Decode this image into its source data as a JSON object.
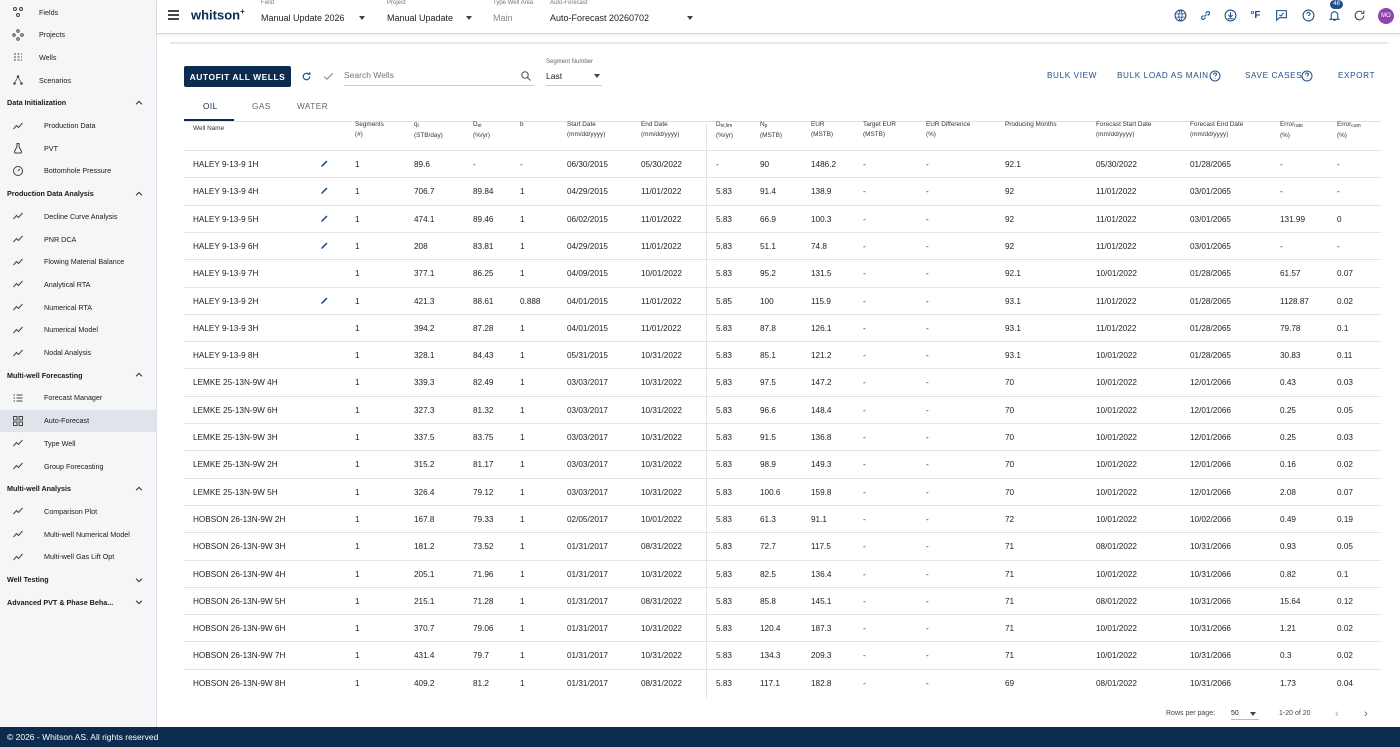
{
  "sidebar": {
    "top": [
      {
        "label": "Fields",
        "icon": "fields-icon"
      },
      {
        "label": "Projects",
        "icon": "projects-icon"
      },
      {
        "label": "Wells",
        "icon": "wells-icon"
      },
      {
        "label": "Scenarios",
        "icon": "scenarios-icon"
      }
    ],
    "sections": [
      {
        "label": "Data Initialization",
        "items": [
          {
            "label": "Production Data",
            "icon": "production-icon"
          },
          {
            "label": "PVT",
            "icon": "flask-icon"
          },
          {
            "label": "Bottomhole Pressure",
            "icon": "gauge-icon"
          }
        ]
      },
      {
        "label": "Production Data Analysis",
        "items": [
          {
            "label": "Decline Curve Analysis",
            "icon": "decline-icon"
          },
          {
            "label": "PNR DCA",
            "icon": "pnr-icon"
          },
          {
            "label": "Flowing Material Balance",
            "icon": "fmb-icon"
          },
          {
            "label": "Analytical RTA",
            "icon": "analytical-icon"
          },
          {
            "label": "Numerical RTA",
            "icon": "numerical-rta-icon"
          },
          {
            "label": "Numerical Model",
            "icon": "model-icon"
          },
          {
            "label": "Nodal Analysis",
            "icon": "nodal-icon"
          }
        ]
      },
      {
        "label": "Multi-well Forecasting",
        "items": [
          {
            "label": "Forecast Manager",
            "icon": "list-icon"
          },
          {
            "label": "Auto-Forecast",
            "icon": "grid-icon"
          },
          {
            "label": "Type Well",
            "icon": "typewell-icon"
          },
          {
            "label": "Group Forecasting",
            "icon": "group-icon"
          }
        ]
      },
      {
        "label": "Multi-well Analysis",
        "items": [
          {
            "label": "Comparison Plot",
            "icon": "comparison-icon"
          },
          {
            "label": "Multi-well Numerical Model",
            "icon": "multimodel-icon"
          },
          {
            "label": "Multi-well Gas Lift Opt",
            "icon": "gaslift-icon"
          }
        ]
      },
      {
        "label": "Well Testing",
        "items": []
      },
      {
        "label": "Advanced PVT & Phase Beha...",
        "items": []
      }
    ]
  },
  "footer": "© 2026 - Whitson AS. All rights reserved",
  "topbar": {
    "brand": "whitson",
    "brand_sup": "+",
    "field": {
      "caption": "Field",
      "value": "Manual Update 2026"
    },
    "project": {
      "caption": "Project",
      "value": "Manual Upadate"
    },
    "type_well_area": {
      "caption": "Type Well Area",
      "value": "Main"
    },
    "auto_forecast": {
      "caption": "Auto-Forecast",
      "value": "Auto-Forecast 20260702"
    },
    "temp_unit": "°F",
    "notifications": "48",
    "avatar": "MO"
  },
  "toolbar": {
    "autofit": "AUTOFIT ALL WELLS",
    "search_placeholder": "Search Wells",
    "segment_caption": "Segment Number",
    "segment_value": "Last",
    "bulk_view": "BULK VIEW",
    "bulk_load": "BULK LOAD AS MAIN",
    "save_cases": "SAVE CASES",
    "export": "EXPORT"
  },
  "tabs": [
    "OIL",
    "GAS",
    "WATER"
  ],
  "columns": [
    {
      "l1": "Well Name",
      "l2": ""
    },
    {
      "l1": "Segments",
      "l2": "(#)"
    },
    {
      "l1": "qi",
      "l2": "(STB/day)"
    },
    {
      "l1": "Dei",
      "l2": "(%/yr)"
    },
    {
      "l1": "b",
      "l2": ""
    },
    {
      "l1": "Start Date",
      "l2": "(mm/dd/yyyy)"
    },
    {
      "l1": "End Date",
      "l2": "(mm/dd/yyyy)"
    },
    {
      "l1": "Dei,lim",
      "l2": "(%/yr)"
    },
    {
      "l1": "Np",
      "l2": "(MSTB)"
    },
    {
      "l1": "EUR",
      "l2": "(MSTB)"
    },
    {
      "l1": "Target EUR",
      "l2": "(MSTB)"
    },
    {
      "l1": "EUR Difference",
      "l2": "(%)"
    },
    {
      "l1": "Producing Months",
      "l2": ""
    },
    {
      "l1": "Forecast Start Date",
      "l2": "(mm/dd/yyyy)"
    },
    {
      "l1": "Forecast End Date",
      "l2": "(mm/dd/yyyy)"
    },
    {
      "l1": "Errorrate",
      "l2": "(%)"
    },
    {
      "l1": "Errorcum",
      "l2": "(%)"
    }
  ],
  "rows": [
    {
      "edit": true,
      "c": [
        "HALEY 9-13-9 1H",
        "1",
        "89.6",
        "-",
        "-",
        "06/30/2015",
        "05/30/2022",
        "-",
        "90",
        "1486.2",
        "-",
        "-",
        "92.1",
        "05/30/2022",
        "01/28/2065",
        "-",
        "-"
      ]
    },
    {
      "edit": true,
      "c": [
        "HALEY 9-13-9 4H",
        "1",
        "706.7",
        "89.84",
        "1",
        "04/29/2015",
        "11/01/2022",
        "5.83",
        "91.4",
        "138.9",
        "-",
        "-",
        "92",
        "11/01/2022",
        "03/01/2065",
        "-",
        "-"
      ]
    },
    {
      "edit": true,
      "c": [
        "HALEY 9-13-9 5H",
        "1",
        "474.1",
        "89.46",
        "1",
        "06/02/2015",
        "11/01/2022",
        "5.83",
        "66.9",
        "100.3",
        "-",
        "-",
        "92",
        "11/01/2022",
        "03/01/2065",
        "131.99",
        "0"
      ]
    },
    {
      "edit": true,
      "c": [
        "HALEY 9-13-9 6H",
        "1",
        "208",
        "83.81",
        "1",
        "04/29/2015",
        "11/01/2022",
        "5.83",
        "51.1",
        "74.8",
        "-",
        "-",
        "92",
        "11/01/2022",
        "03/01/2065",
        "-",
        "-"
      ]
    },
    {
      "edit": false,
      "c": [
        "HALEY 9-13-9 7H",
        "1",
        "377.1",
        "86.25",
        "1",
        "04/09/2015",
        "10/01/2022",
        "5.83",
        "95.2",
        "131.5",
        "-",
        "-",
        "92.1",
        "10/01/2022",
        "01/28/2065",
        "61.57",
        "0.07"
      ]
    },
    {
      "edit": true,
      "c": [
        "HALEY 9-13-9 2H",
        "1",
        "421.3",
        "88.61",
        "0.888",
        "04/01/2015",
        "11/01/2022",
        "5.85",
        "100",
        "115.9",
        "-",
        "-",
        "93.1",
        "11/01/2022",
        "01/28/2065",
        "1128.87",
        "0.02"
      ]
    },
    {
      "edit": false,
      "c": [
        "HALEY 9-13-9 3H",
        "1",
        "394.2",
        "87.28",
        "1",
        "04/01/2015",
        "11/01/2022",
        "5.83",
        "87.8",
        "126.1",
        "-",
        "-",
        "93.1",
        "11/01/2022",
        "01/28/2065",
        "79.78",
        "0.1"
      ]
    },
    {
      "edit": false,
      "c": [
        "HALEY 9-13-9 8H",
        "1",
        "328.1",
        "84.43",
        "1",
        "05/31/2015",
        "10/31/2022",
        "5.83",
        "85.1",
        "121.2",
        "-",
        "-",
        "93.1",
        "10/01/2022",
        "01/28/2065",
        "30.83",
        "0.11"
      ]
    },
    {
      "edit": false,
      "c": [
        "LEMKE 25-13N-9W 4H",
        "1",
        "339.3",
        "82.49",
        "1",
        "03/03/2017",
        "10/31/2022",
        "5.83",
        "97.5",
        "147.2",
        "-",
        "-",
        "70",
        "10/01/2022",
        "12/01/2066",
        "0.43",
        "0.03"
      ]
    },
    {
      "edit": false,
      "c": [
        "LEMKE 25-13N-9W 6H",
        "1",
        "327.3",
        "81.32",
        "1",
        "03/03/2017",
        "10/31/2022",
        "5.83",
        "96.6",
        "148.4",
        "-",
        "-",
        "70",
        "10/01/2022",
        "12/01/2066",
        "0.25",
        "0.05"
      ]
    },
    {
      "edit": false,
      "c": [
        "LEMKE 25-13N-9W 3H",
        "1",
        "337.5",
        "83.75",
        "1",
        "03/03/2017",
        "10/31/2022",
        "5.83",
        "91.5",
        "136.8",
        "-",
        "-",
        "70",
        "10/01/2022",
        "12/01/2066",
        "0.25",
        "0.03"
      ]
    },
    {
      "edit": false,
      "c": [
        "LEMKE 25-13N-9W 2H",
        "1",
        "315.2",
        "81.17",
        "1",
        "03/03/2017",
        "10/31/2022",
        "5.83",
        "98.9",
        "149.3",
        "-",
        "-",
        "70",
        "10/01/2022",
        "12/01/2066",
        "0.16",
        "0.02"
      ]
    },
    {
      "edit": false,
      "c": [
        "LEMKE 25-13N-9W 5H",
        "1",
        "326.4",
        "79.12",
        "1",
        "03/03/2017",
        "10/31/2022",
        "5.83",
        "100.6",
        "159.8",
        "-",
        "-",
        "70",
        "10/01/2022",
        "12/01/2066",
        "2.08",
        "0.07"
      ]
    },
    {
      "edit": false,
      "c": [
        "HOBSON 26-13N-9W 2H",
        "1",
        "167.8",
        "79.33",
        "1",
        "02/05/2017",
        "10/01/2022",
        "5.83",
        "61.3",
        "91.1",
        "-",
        "-",
        "72",
        "10/01/2022",
        "10/02/2066",
        "0.49",
        "0.19"
      ]
    },
    {
      "edit": false,
      "c": [
        "HOBSON 26-13N-9W 3H",
        "1",
        "181.2",
        "73.52",
        "1",
        "01/31/2017",
        "08/31/2022",
        "5.83",
        "72.7",
        "117.5",
        "-",
        "-",
        "71",
        "08/01/2022",
        "10/31/2066",
        "0.93",
        "0.05"
      ]
    },
    {
      "edit": false,
      "c": [
        "HOBSON 26-13N-9W 4H",
        "1",
        "205.1",
        "71.96",
        "1",
        "01/31/2017",
        "10/31/2022",
        "5.83",
        "82.5",
        "136.4",
        "-",
        "-",
        "71",
        "10/01/2022",
        "10/31/2066",
        "0.82",
        "0.1"
      ]
    },
    {
      "edit": false,
      "c": [
        "HOBSON 26-13N-9W 5H",
        "1",
        "215.1",
        "71.28",
        "1",
        "01/31/2017",
        "08/31/2022",
        "5.83",
        "85.8",
        "145.1",
        "-",
        "-",
        "71",
        "08/01/2022",
        "10/31/2066",
        "15.64",
        "0.12"
      ]
    },
    {
      "edit": false,
      "c": [
        "HOBSON 26-13N-9W 6H",
        "1",
        "370.7",
        "79.06",
        "1",
        "01/31/2017",
        "10/31/2022",
        "5.83",
        "120.4",
        "187.3",
        "-",
        "-",
        "71",
        "10/01/2022",
        "10/31/2066",
        "1.21",
        "0.02"
      ]
    },
    {
      "edit": false,
      "c": [
        "HOBSON 26-13N-9W 7H",
        "1",
        "431.4",
        "79.7",
        "1",
        "01/31/2017",
        "10/31/2022",
        "5.83",
        "134.3",
        "209.3",
        "-",
        "-",
        "71",
        "10/01/2022",
        "10/31/2066",
        "0.3",
        "0.02"
      ]
    },
    {
      "edit": false,
      "c": [
        "HOBSON 26-13N-9W 8H",
        "1",
        "409.2",
        "81.2",
        "1",
        "01/31/2017",
        "08/31/2022",
        "5.83",
        "117.1",
        "182.8",
        "-",
        "-",
        "69",
        "08/01/2022",
        "10/31/2066",
        "1.73",
        "0.04"
      ]
    }
  ],
  "pagination": {
    "rows_per_page_label": "Rows per page:",
    "rows_per_page": "50",
    "range": "1-20 of 20"
  },
  "colors": {
    "navy": "#0b2b4f",
    "link": "#1f4f86",
    "purple": "#8e44ad"
  }
}
